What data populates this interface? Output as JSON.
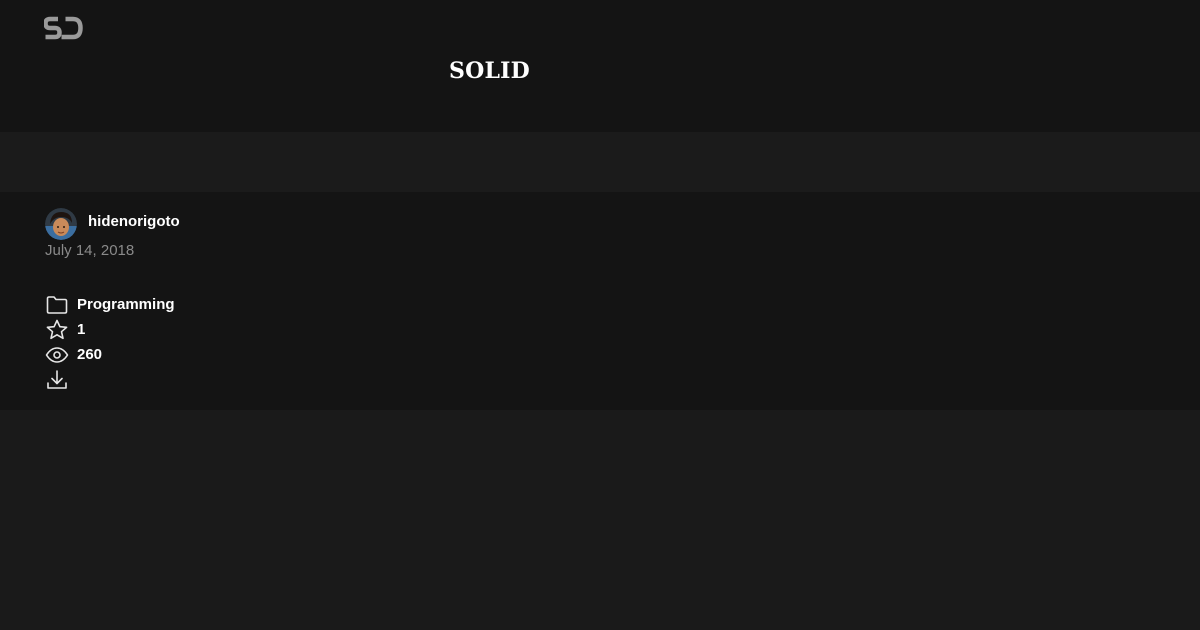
{
  "brand": {
    "logo_icon": "speakerdeck-logo-icon",
    "logo_text": "SD"
  },
  "deck": {
    "title": "SOLID"
  },
  "author": {
    "name": "hidenorigoto",
    "avatar_icon": "user-avatar"
  },
  "published_date": "July 14, 2018",
  "stats": {
    "category": {
      "icon": "folder-icon",
      "label": "Programming"
    },
    "stars": {
      "icon": "star-icon",
      "count": "1"
    },
    "views": {
      "icon": "eye-icon",
      "count": "260"
    },
    "download": {
      "icon": "download-icon"
    }
  },
  "colors": {
    "header_bg": "#141414",
    "band_bg": "#1b1b1b",
    "page_bg": "#1a1a1a",
    "text_primary": "#ffffff",
    "text_secondary": "#8a8a8a",
    "icon": "#e6e6e6"
  }
}
